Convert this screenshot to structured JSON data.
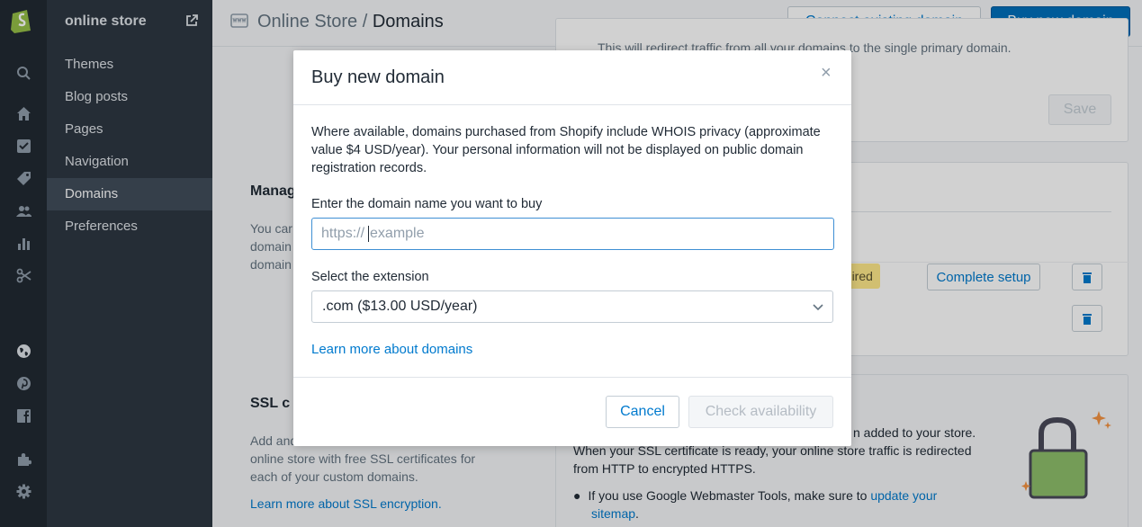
{
  "sidebar": {
    "store_title": "online store",
    "items": [
      {
        "label": "Themes"
      },
      {
        "label": "Blog posts"
      },
      {
        "label": "Pages"
      },
      {
        "label": "Navigation"
      },
      {
        "label": "Domains"
      },
      {
        "label": "Preferences"
      }
    ],
    "active_item": "Domains"
  },
  "header": {
    "breadcrumb_parent": "Online Store / ",
    "breadcrumb_current": "Domains",
    "connect_button": "Connect existing domain",
    "buy_button": "Buy new domain"
  },
  "background": {
    "primary_text_partial": "This will redirect traffic from all your domains to the single primary domain.",
    "save_button": "Save",
    "manage_title_partial": "Manag",
    "manage_text_partial": [
      "You car",
      "domain",
      "domain"
    ],
    "status_badge_partial": "quired",
    "complete_setup_button": "Complete setup",
    "ssl_title_partial": "SSL c",
    "ssl_text": [
      "Add and",
      "online store with free SSL certificates for",
      "each of your custom domains."
    ],
    "ssl_link": "Learn more about SSL encryption.",
    "ssl_card_line1_partial": "n added to your store.",
    "ssl_card_line2": "When your SSL certificate is ready, your online store traffic is redirected",
    "ssl_card_line3": "from HTTP to encrypted HTTPS.",
    "ssl_bullet_prefix": "If you use Google Webmaster Tools, make sure to ",
    "ssl_bullet_link1": "update your",
    "ssl_bullet_link2": "sitemap",
    "ssl_bullet_suffix": "."
  },
  "modal": {
    "title": "Buy new domain",
    "close_glyph": "×",
    "description": "Where available, domains purchased from Shopify include WHOIS privacy (approximate value $4 USD/year). Your personal information will not be displayed on public domain registration records.",
    "domain_label": "Enter the domain name you want to buy",
    "domain_prefix": "https://",
    "domain_placeholder": "example",
    "extension_label": "Select the extension",
    "extension_value": ".com ($13.00 USD/year)",
    "learn_more_link": "Learn more about domains",
    "cancel_button": "Cancel",
    "check_button": "Check availability"
  },
  "colors": {
    "rail_bg": "#222a33",
    "subnav_bg": "#2e3742",
    "link": "#007ace",
    "primary": "#006fbb",
    "badge": "#ffea8a",
    "lock_green": "#8ebf6b"
  }
}
